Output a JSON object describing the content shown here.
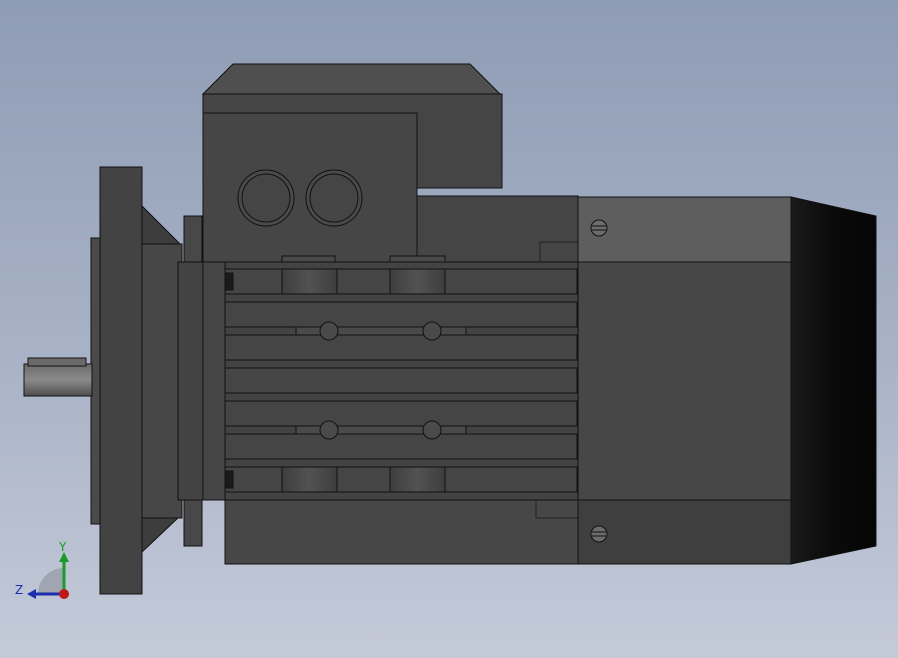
{
  "viewport": {
    "model": "flange-motor-side-view",
    "background_top": "#8e9cb4",
    "background_bottom": "#c4cad8"
  },
  "axis_triad": {
    "y_label": "Y",
    "z_label": "Z",
    "y_color": "#1a9a2a",
    "z_color": "#1b2fb0",
    "origin_color": "#c01818"
  }
}
